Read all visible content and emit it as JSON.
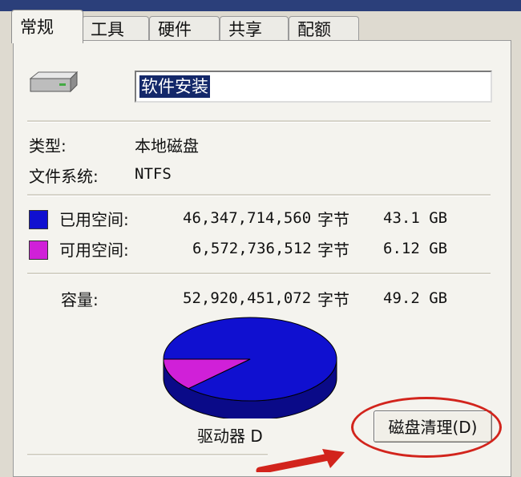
{
  "tabs": [
    {
      "label": "常规"
    },
    {
      "label": "工具"
    },
    {
      "label": "硬件"
    },
    {
      "label": "共享"
    },
    {
      "label": "配额"
    }
  ],
  "drive": {
    "icon": "hard-drive-icon",
    "name": "软件安装",
    "type_label": "类型:",
    "type_value": "本地磁盘",
    "fs_label": "文件系统:",
    "fs_value": "NTFS"
  },
  "usage": {
    "used": {
      "label": "已用空间:",
      "bytes": "46,347,714,560",
      "unit": "字节",
      "human": "43.1 GB",
      "color": "#1010d0"
    },
    "free": {
      "label": "可用空间:",
      "bytes": "6,572,736,512",
      "unit": "字节",
      "human": "6.12 GB",
      "color": "#d020d8"
    },
    "capacity": {
      "label": "容量:",
      "bytes": "52,920,451,072",
      "unit": "字节",
      "human": "49.2 GB"
    }
  },
  "chart_data": {
    "type": "pie",
    "categories": [
      "已用空间",
      "可用空间"
    ],
    "values": [
      46347714560,
      6572736512
    ],
    "colors": [
      "#1010d0",
      "#d020d8"
    ]
  },
  "drive_label": "驱动器 D",
  "cleanup_button": {
    "label": "磁盘清理(D)"
  }
}
